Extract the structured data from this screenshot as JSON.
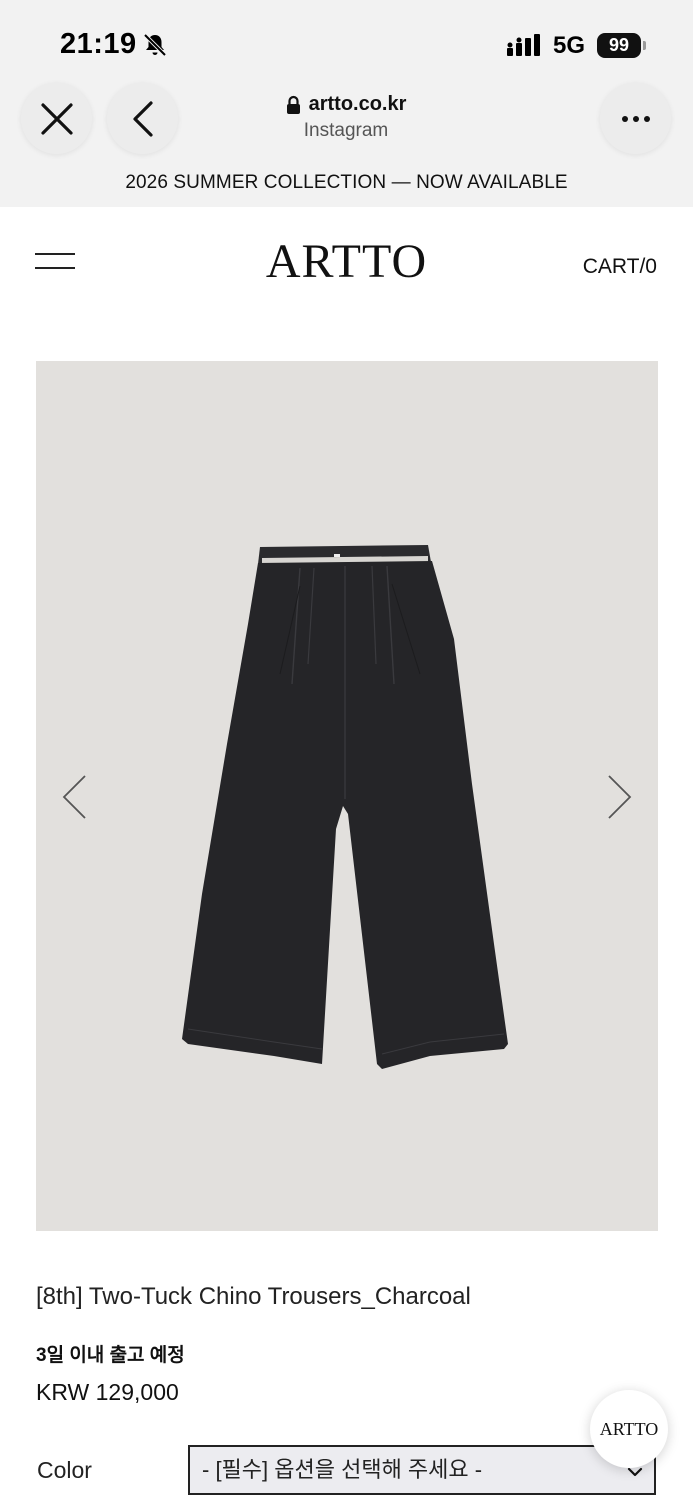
{
  "status_bar": {
    "time": "21:19",
    "network": "5G",
    "battery": "99",
    "icons": [
      "bell-slash-icon",
      "signal-icon"
    ]
  },
  "browser": {
    "url": "artto.co.kr",
    "source": "Instagram",
    "icons": [
      "close-icon",
      "back-icon",
      "lock-icon",
      "more-icon"
    ]
  },
  "banner": {
    "text": "2026 SUMMER COLLECTION — NOW AVAILABLE"
  },
  "header": {
    "logo": "ARTTO",
    "cart": "CART/0",
    "menu_icon": "hamburger-icon"
  },
  "gallery": {
    "background": "#e2e0dd",
    "icons": [
      "chevron-left-icon",
      "chevron-right-icon"
    ]
  },
  "product": {
    "name": "[8th] Two-Tuck Chino Trousers_Charcoal",
    "shipping_note": "3일 이내 출고 예정",
    "price": "KRW 129,000",
    "option_label": "Color",
    "option_placeholder": "- [필수] 옵션을 선택해 주세요 -"
  },
  "chat": {
    "label": "ARTTO"
  }
}
